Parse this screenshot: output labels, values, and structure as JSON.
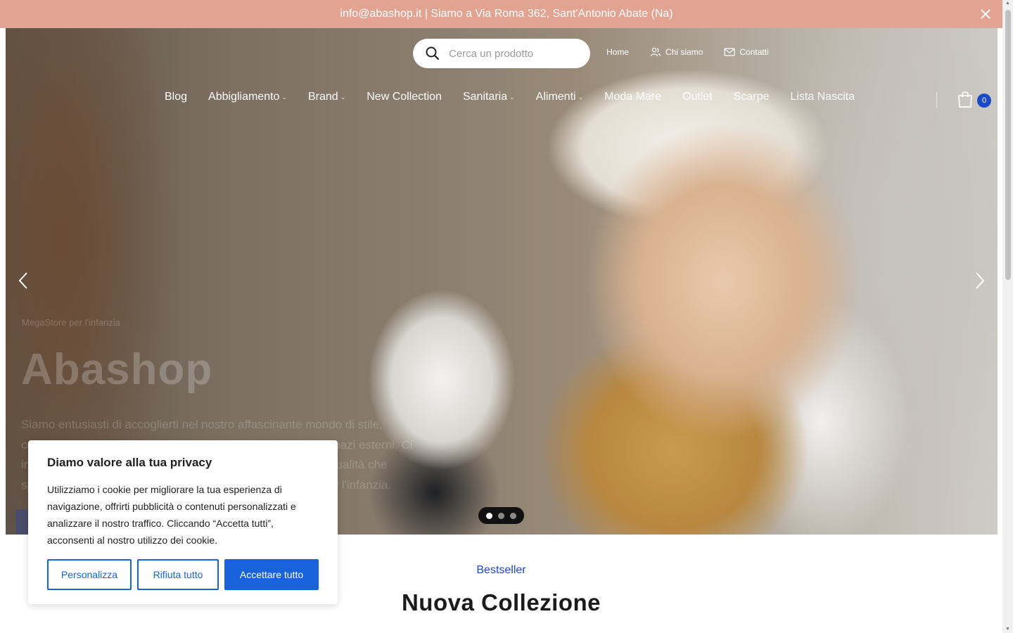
{
  "topbar": {
    "text": "info@abashop.it | Siamo a Via Roma 362, Sant'Antonio Abate (Na)"
  },
  "search": {
    "placeholder": "Cerca un prodotto"
  },
  "toplinks": {
    "home": "Home",
    "about": "Chi siamo",
    "contacts": "Contatti"
  },
  "nav": {
    "items": [
      {
        "label": "Blog",
        "has_dropdown": false
      },
      {
        "label": "Abbigliamento",
        "has_dropdown": true
      },
      {
        "label": "Brand",
        "has_dropdown": true
      },
      {
        "label": "New Collection",
        "has_dropdown": false
      },
      {
        "label": "Sanitaria",
        "has_dropdown": true
      },
      {
        "label": "Alimenti",
        "has_dropdown": true
      },
      {
        "label": "Moda Mare",
        "has_dropdown": false
      },
      {
        "label": "Outlet",
        "has_dropdown": false
      },
      {
        "label": "Scarpe",
        "has_dropdown": false
      },
      {
        "label": "Lista Nascita",
        "has_dropdown": false
      }
    ]
  },
  "cart": {
    "count": "0",
    "badge_color": "#1a49c9"
  },
  "hero": {
    "kicker": "MegaStore per l'infanzia",
    "title": "Abashop",
    "description": "Siamo entusiasti di accoglierti nel nostro affascinante mondo di stile, comfort e ispirazione dedicato alla cura della casa e degli spazi esterni. Ci impegniamo ad offrire una vasta gamma di prodotti di alta qualità che spaziano dall'arredamento agli accessori e complementi per l'infanzia.",
    "slides_total": 3,
    "active_slide": 1
  },
  "section": {
    "kicker": "Bestseller",
    "title": "Nuova Collezione"
  },
  "cookie": {
    "title": "Diamo valore alla tua privacy",
    "body": "Utilizziamo i cookie per migliorare la tua esperienza di navigazione, offrirti pubblicità o contenuti personalizzati e analizzare il nostro traffico. Cliccando “Accetta tutti”, acconsenti al nostro utilizzo dei cookie.",
    "customize": "Personalizza",
    "reject": "Rifiuta tutto",
    "accept": "Accettare tutto",
    "accent_color": "#1863dc"
  },
  "colors": {
    "topbar_bg": "#e3a391",
    "brand_blue": "#1a49c9"
  }
}
